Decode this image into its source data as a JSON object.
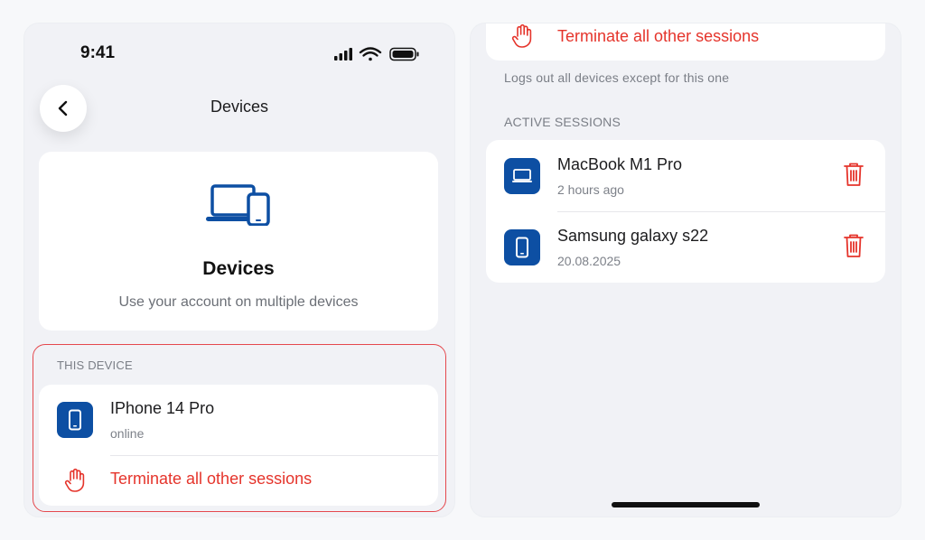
{
  "status_bar": {
    "time": "9:41"
  },
  "nav": {
    "title": "Devices"
  },
  "hero": {
    "title": "Devices",
    "subtitle": "Use your account on multiple devices"
  },
  "this_device": {
    "section_label": "THIS DEVICE",
    "device_name": "IPhone 14 Pro",
    "device_status": "online",
    "terminate_label": "Terminate all other sessions"
  },
  "right_panel": {
    "terminate_label": "Terminate all other sessions",
    "terminate_hint": "Logs out all devices except for this one",
    "active_label": "ACTIVE SESSIONS",
    "sessions": [
      {
        "name": "MacBook M1 Pro",
        "time": "2 hours ago",
        "icon": "laptop-icon"
      },
      {
        "name": "Samsung galaxy s22",
        "time": "20.08.2025",
        "icon": "phone-icon"
      }
    ]
  },
  "colors": {
    "accent_blue": "#0d4fa3",
    "danger_red": "#e5342b",
    "highlight_border": "#e5484d",
    "background": "#f1f2f6"
  }
}
